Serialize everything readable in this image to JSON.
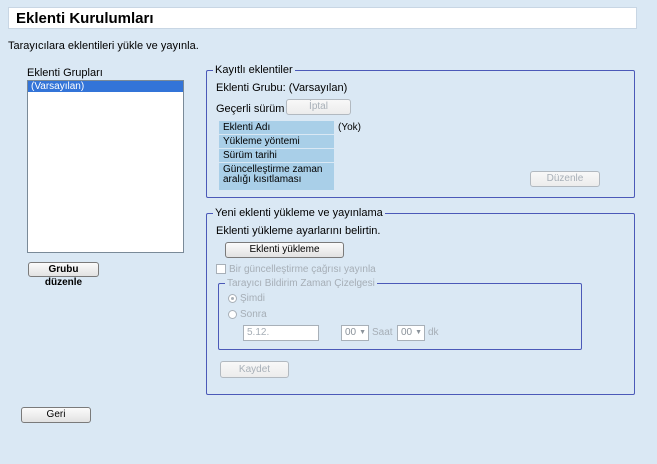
{
  "header": {
    "title": "Eklenti Kurulumları"
  },
  "subtitle": "Tarayıcılara eklentileri yükle ve yayınla.",
  "groups": {
    "label": "Eklenti Grupları",
    "items": [
      {
        "label": "(Varsayılan)",
        "selected": true
      },
      {
        "label": "",
        "selected": false
      },
      {
        "label": "",
        "selected": false
      }
    ],
    "edit_button": "Grubu düzenle"
  },
  "registered": {
    "legend": "Kayıtlı eklentiler",
    "group_line": "Eklenti Grubu: (Varsayılan)",
    "version_label": "Geçerli sürüm",
    "cancel_button": "İptal",
    "table": {
      "rows": [
        {
          "label": "Eklenti Adı",
          "value": "(Yok)"
        },
        {
          "label": "Yükleme yöntemi",
          "value": ""
        },
        {
          "label": "Sürüm tarihi",
          "value": ""
        },
        {
          "label": "Güncelleştirme zaman aralığı kısıtlaması",
          "value": ""
        }
      ]
    },
    "edit_button": "Düzenle"
  },
  "new_plugin": {
    "legend": "Yeni eklenti yükleme ve yayınlama",
    "instruction": "Eklenti yükleme ayarlarını belirtin.",
    "upload_button": "Eklenti yükleme",
    "publish_checkbox": "Bir güncelleştirme çağrısı yayınla",
    "timeline": {
      "legend": "Tarayıcı Bildirim Zaman Çizelgesi",
      "now": "Şimdi",
      "later": "Sonra",
      "date_value": "5.12.",
      "hour_value": "00",
      "hour_label": "Saat",
      "minute_value": "00",
      "minute_label": "dk"
    },
    "save_button": "Kaydet"
  },
  "back_button": "Geri"
}
